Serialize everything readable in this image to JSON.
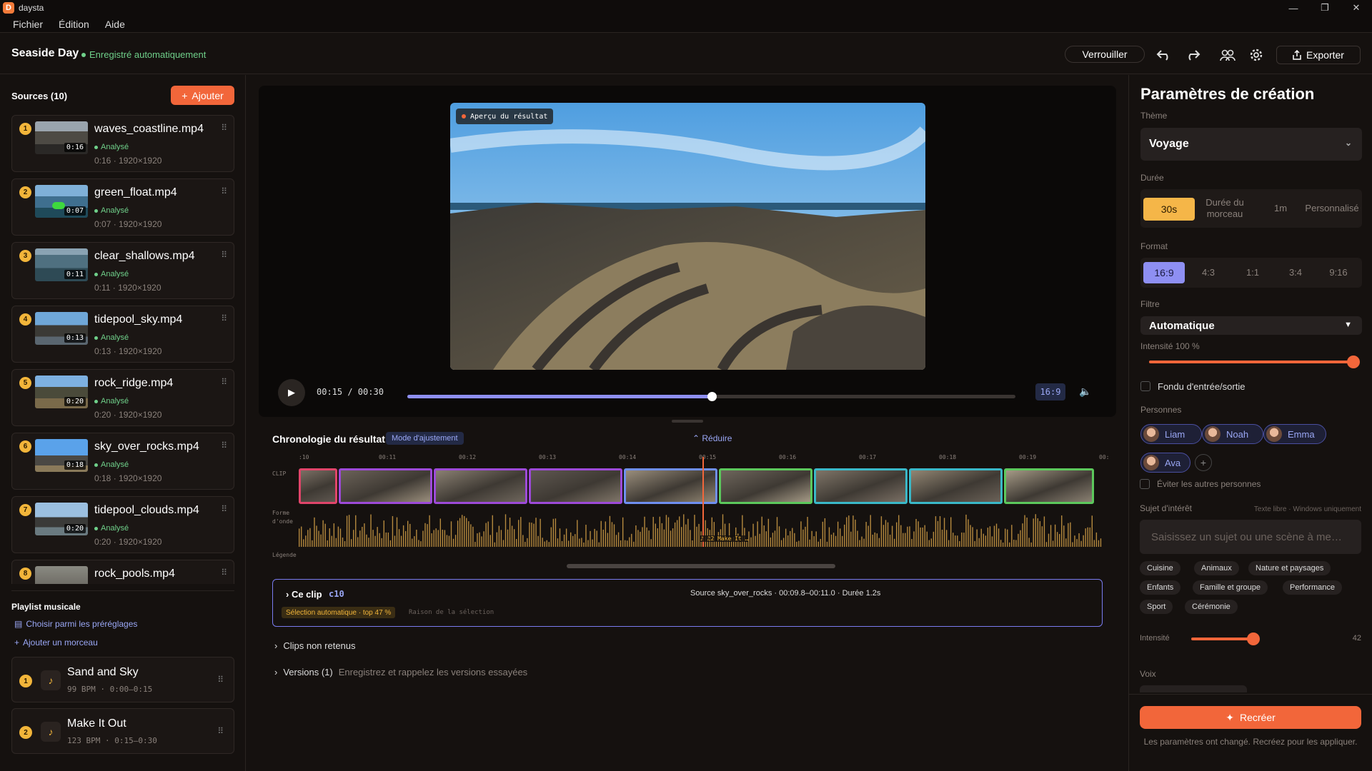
{
  "app": {
    "name": "daysta",
    "icon_letter": "D"
  },
  "menu": [
    "Fichier",
    "Édition",
    "Aide"
  ],
  "header": {
    "project_title": "Seaside Day",
    "save_status": "Enregistré automatiquement",
    "lock_label": "Verrouiller",
    "export_label": "Exporter"
  },
  "sources": {
    "title": "Sources (10)",
    "add_label": "Ajouter",
    "items": [
      {
        "num": "1",
        "name": "waves_coastline.mp4",
        "duration": "0:16",
        "status": "Analysé",
        "meta": "0:16 · 1920×1920"
      },
      {
        "num": "2",
        "name": "green_float.mp4",
        "duration": "0:07",
        "status": "Analysé",
        "meta": "0:07 · 1920×1920"
      },
      {
        "num": "3",
        "name": "clear_shallows.mp4",
        "duration": "0:11",
        "status": "Analysé",
        "meta": "0:11 · 1920×1920"
      },
      {
        "num": "4",
        "name": "tidepool_sky.mp4",
        "duration": "0:13",
        "status": "Analysé",
        "meta": "0:13 · 1920×1920"
      },
      {
        "num": "5",
        "name": "rock_ridge.mp4",
        "duration": "0:20",
        "status": "Analysé",
        "meta": "0:20 · 1920×1920"
      },
      {
        "num": "6",
        "name": "sky_over_rocks.mp4",
        "duration": "0:18",
        "status": "Analysé",
        "meta": "0:18 · 1920×1920"
      },
      {
        "num": "7",
        "name": "tidepool_clouds.mp4",
        "duration": "0:20",
        "status": "Analysé",
        "meta": "0:20 · 1920×1920"
      },
      {
        "num": "8",
        "name": "rock_pools.mp4",
        "duration": "",
        "status": "",
        "meta": ""
      }
    ]
  },
  "playlist": {
    "title": "Playlist musicale",
    "presets_link": "Choisir parmi les préréglages",
    "add_link": "Ajouter un morceau",
    "songs": [
      {
        "num": "1",
        "name": "Sand and Sky",
        "meta": "99 BPM · 0:00–0:15"
      },
      {
        "num": "2",
        "name": "Make It Out",
        "meta": "123 BPM · 0:15–0:30"
      }
    ]
  },
  "preview": {
    "badge": "Aperçu du résultat",
    "timecode": "00:15 / 00:30",
    "progress": 0.5,
    "aspect": "16:9"
  },
  "timeline": {
    "title": "Chronologie du résultat",
    "mode": "Mode d'ajustement",
    "reduce": "Réduire",
    "ticks": [
      ":10",
      "00:11",
      "00:12",
      "00:13",
      "00:14",
      "00:15",
      "00:16",
      "00:17",
      "00:18",
      "00:19",
      "00:"
    ],
    "row_clip": "CLIP",
    "row_wave": "Forme d'onde",
    "row_legend": "Légende",
    "playhead_label": "♪ ♫2 Make It …",
    "clips": [
      {
        "color": "#e0456a"
      },
      {
        "color": "#9d4ad8"
      },
      {
        "color": "#9d4ad8"
      },
      {
        "color": "#9d4ad8"
      },
      {
        "color": "#6f8ff0"
      },
      {
        "color": "#5cc85c"
      },
      {
        "color": "#3ab8c8"
      },
      {
        "color": "#3ab8c8"
      },
      {
        "color": "#5cc85c"
      }
    ]
  },
  "clip_info": {
    "title": "Ce clip",
    "id": "c10",
    "source": "Source sky_over_rocks · 00:09.8–00:11.0 · Durée 1.2s",
    "badge": "Sélection automatique · top 47 %",
    "reason": "Raison de la sélection"
  },
  "sections": {
    "rejected": "Clips non retenus",
    "versions": "Versions (1)",
    "versions_hint": "Enregistrez et rappelez les versions essayées"
  },
  "settings": {
    "title": "Paramètres de création",
    "theme_label": "Thème",
    "theme_value": "Voyage",
    "duration_label": "Durée",
    "duration_options": [
      "30s",
      "Durée du morceau",
      "1m",
      "Personnalisé"
    ],
    "format_label": "Format",
    "format_options": [
      "16:9",
      "4:3",
      "1:1",
      "3:4",
      "9:16"
    ],
    "filter_label": "Filtre",
    "filter_value": "Automatique",
    "intensity_label": "Intensité 100 %",
    "intensity_value": 1.0,
    "fade_label": "Fondu d'entrée/sortie",
    "people_label": "Personnes",
    "people": [
      "Liam",
      "Noah",
      "Emma",
      "Ava"
    ],
    "avoid_label": "Éviter les autres personnes",
    "subject_label": "Sujet d'intérêt",
    "subject_hint": "Texte libre · Windows uniquement",
    "subject_placeholder": "Saisissez un sujet ou une scène à me…",
    "tags": [
      "Cuisine",
      "Animaux",
      "Nature et paysages",
      "Enfants",
      "Famille et groupe",
      "Performance",
      "Sport",
      "Cérémonie"
    ],
    "subject_intensity_label": "Intensité",
    "subject_intensity_value": "42",
    "voice_label": "Voix",
    "recreate_label": "Recréer",
    "note": "Les paramètres ont changé. Recréez pour les appliquer."
  },
  "colors": {
    "accent": "#f2663a",
    "blue": "#9aa7f5",
    "green": "#6fd08a",
    "yellow": "#f2b53a"
  }
}
